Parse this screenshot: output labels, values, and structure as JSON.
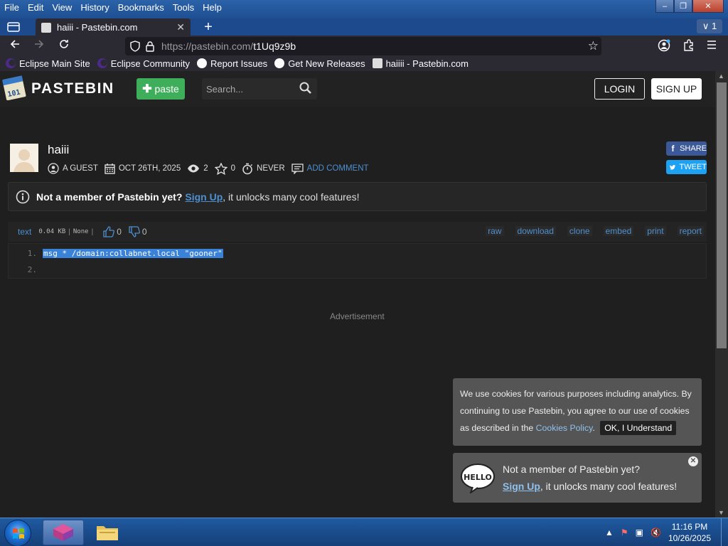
{
  "menu": [
    "File",
    "Edit",
    "View",
    "History",
    "Bookmarks",
    "Tools",
    "Help"
  ],
  "window_controls": {
    "minimize": "–",
    "restore": "❐",
    "close": "✕"
  },
  "tab": {
    "title": "haiii - Pastebin.com",
    "close": "✕",
    "new_tab": "+",
    "count": "1"
  },
  "url": {
    "host": "https://pastebin.com/",
    "path": "t1Uq9z9b"
  },
  "bookmarks": [
    {
      "label": "Eclipse Main Site",
      "icon": "eclipse"
    },
    {
      "label": "Eclipse Community",
      "icon": "eclipse"
    },
    {
      "label": "Report Issues",
      "icon": "github"
    },
    {
      "label": "Get New Releases",
      "icon": "github"
    },
    {
      "label": "haiiii - Pastebin.com",
      "icon": "pastebin"
    }
  ],
  "header": {
    "logo_text": "PASTEBIN",
    "logo_mark": "101",
    "paste_label": "paste",
    "search_placeholder": "Search...",
    "login_label": "LOGIN",
    "signup_label": "SIGN UP"
  },
  "paste": {
    "title": "haiii",
    "author": "A GUEST",
    "date": "OCT 26TH, 2025",
    "views": "2",
    "stars": "0",
    "expiry": "NEVER",
    "add_comment": "ADD COMMENT",
    "share_label": "SHARE",
    "tweet_label": "TWEET"
  },
  "notice": {
    "bold": "Not a member of Pastebin yet?",
    "link": "Sign Up",
    "rest": ", it unlocks many cool features!"
  },
  "code": {
    "syntax": "text",
    "size": "0.04 KB",
    "separator": "|",
    "category": "None",
    "likes": "0",
    "dislikes": "0",
    "actions": [
      "raw",
      "download",
      "clone",
      "embed",
      "print",
      "report"
    ],
    "lines": [
      {
        "num": "1.",
        "text": "msg * /domain:collabnet.local \"gooner\""
      },
      {
        "num": "2.",
        "text": ""
      }
    ]
  },
  "advertisement": "Advertisement",
  "cookie_popup": {
    "text": "We use cookies for various purposes including analytics. By continuing to use Pastebin, you agree to our use of cookies as described in the ",
    "link": "Cookies Policy",
    "period": ".",
    "button": "OK, I Understand"
  },
  "hello_popup": {
    "icon_text": "HELLO",
    "line1": "Not a member of Pastebin yet?",
    "link": "Sign Up",
    "line2_rest": ", it unlocks many cool features!",
    "close": "✕"
  },
  "taskbar": {
    "time": "11:16 PM",
    "date": "10/26/2025"
  },
  "colors": {
    "accent_blue": "#4e8fd0",
    "paste_green": "#3eae5a",
    "selection": "#3a82d8"
  }
}
